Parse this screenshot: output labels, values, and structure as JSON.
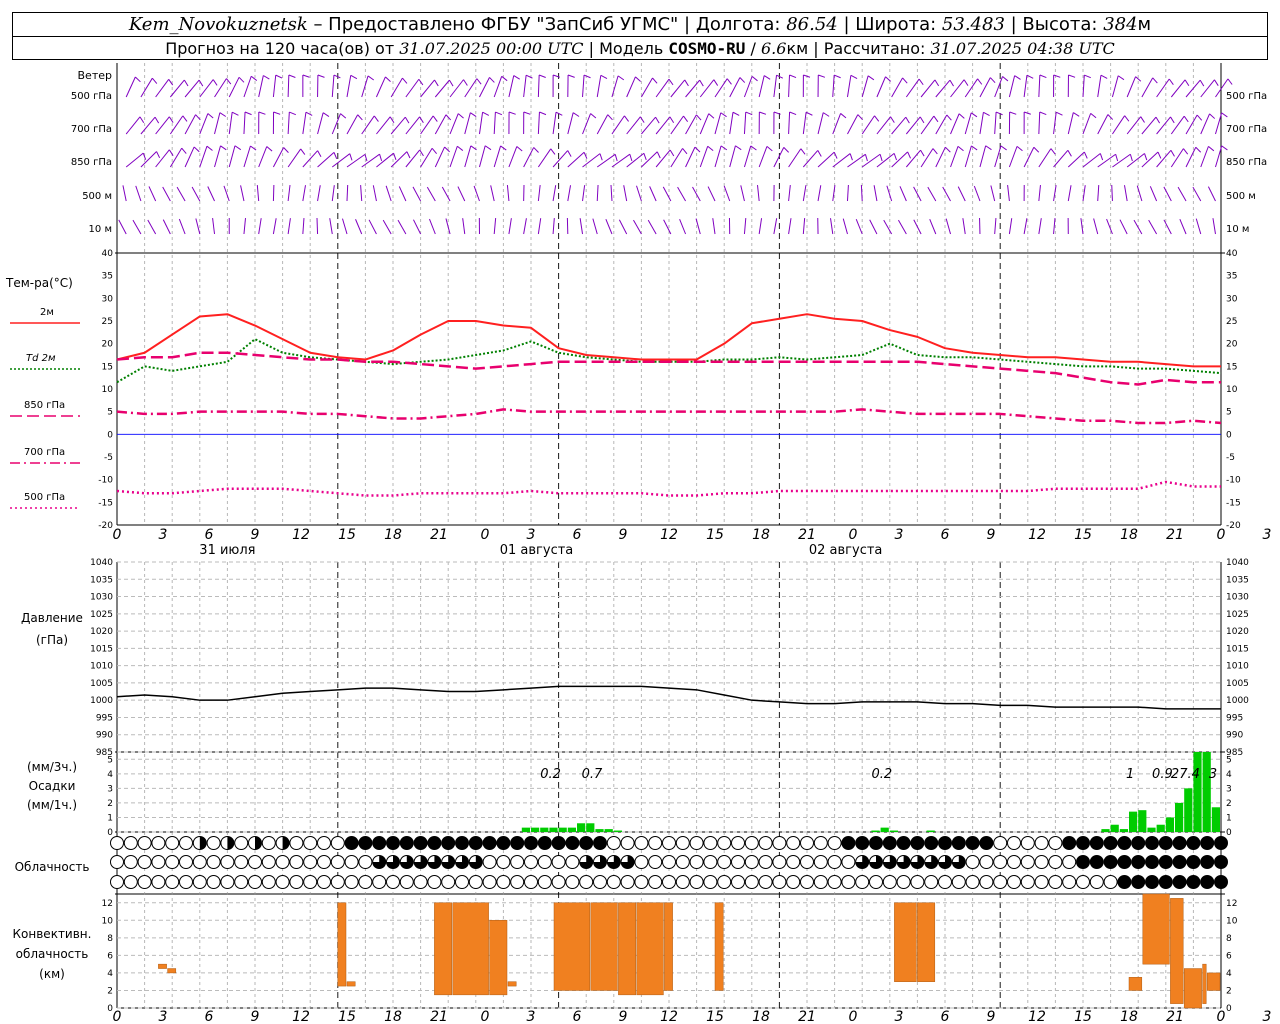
{
  "header": {
    "station": "Kem_Novokuznetsk",
    "sep1": " – Предоставлено ФГБУ \"ЗапСиб УГМС\" | Долгота: ",
    "lon": "86.54",
    "sep2": " | Широта: ",
    "lat": "53.483",
    "sep3": " | Высота: ",
    "alt": "384",
    "alt_unit": "м",
    "line2_a": "Прогноз на 120 часа(ов) от ",
    "run": "31.07.2025 00:00 UTC",
    "line2_b": "  | Модель ",
    "model": "COSMO-RU",
    "line2_c": " / ",
    "res": "6.6",
    "res_unit": "км",
    "line2_d": " | Рассчитано: ",
    "calc": "31.07.2025 04:38 UTC"
  },
  "colors": {
    "t2m": "#ff2020",
    "td": "#008000",
    "t850": "#e8006e",
    "t700": "#e8006e",
    "t500": "#e8008c",
    "wind": "#8000c0",
    "pressure": "#000000",
    "precip": "#00cc00",
    "conv": "#f08020",
    "zero": "#0000ff"
  },
  "time_axis": {
    "hour_ticks": [
      "0",
      "3",
      "6",
      "9",
      "12",
      "15",
      "18",
      "21",
      "0",
      "3",
      "6",
      "9",
      "12",
      "15",
      "18",
      "21",
      "0",
      "3",
      "6",
      "9",
      "12",
      "15",
      "18",
      "21",
      "0",
      "3",
      "6"
    ],
    "days": [
      "31 июля",
      "01 августа",
      "02 августа"
    ]
  },
  "wind_panel": {
    "title": "Ветер",
    "levels": [
      "500 гПа",
      "700 гПа",
      "850 гПа",
      "500 м",
      "10 м"
    ]
  },
  "temp_panel": {
    "title": "Тем-ра(°C)",
    "legend": [
      {
        "label": "2м",
        "style": "solid"
      },
      {
        "label": "Td  2м",
        "style": "dotted"
      },
      {
        "label": "850 гПа",
        "style": "dash"
      },
      {
        "label": "700 гПа",
        "style": "dashdot"
      },
      {
        "label": "500 гПа",
        "style": "dot"
      }
    ],
    "yticks": [
      "40",
      "35",
      "30",
      "25",
      "20",
      "15",
      "10",
      "5",
      "0",
      "-5",
      "-10",
      "-15",
      "-20"
    ]
  },
  "pressure_panel": {
    "title": "Давление",
    "unit": "(гПа)",
    "yticks": [
      "1040",
      "1035",
      "1030",
      "1025",
      "1020",
      "1015",
      "1010",
      "1005",
      "1000",
      "995",
      "990",
      "985"
    ]
  },
  "precip_panel": {
    "label1": "(мм/3ч.)",
    "label2": "Осадки",
    "label3": "(мм/1ч.)",
    "yticks": [
      "5",
      "4",
      "3",
      "2",
      "1",
      "0"
    ],
    "annotations": [
      {
        "h": 48,
        "text": "0.2"
      },
      {
        "h": 52.5,
        "text": "0.7"
      },
      {
        "h": 84,
        "text": "0.2"
      },
      {
        "h": 111,
        "text": "1"
      },
      {
        "h": 114.5,
        "text": "0.9"
      },
      {
        "h": 117,
        "text": "27.4"
      },
      {
        "h": 120,
        "text": "3"
      }
    ]
  },
  "cloud_panel": {
    "title": "Облачность"
  },
  "conv_panel": {
    "title1": "Конвективн.",
    "title2": "облачность",
    "title3": "(км)",
    "yticks": [
      "12",
      "10",
      "8",
      "6",
      "4",
      "2",
      "0"
    ]
  },
  "chart_data": [
    {
      "type": "line",
      "name": "temperature",
      "x_unit": "hours from 31.07.2025 00 UTC",
      "ylim": [
        -20,
        40
      ],
      "series": [
        {
          "name": "2м",
          "x": [
            0,
            3,
            6,
            9,
            12,
            15,
            18,
            21,
            24,
            27,
            30,
            33,
            36,
            39,
            42,
            45,
            48,
            51,
            54,
            57,
            60,
            63,
            66,
            69,
            72,
            75,
            78,
            81,
            84,
            87,
            90,
            93,
            96,
            99,
            102,
            105,
            108,
            111,
            114,
            117,
            120
          ],
          "values": [
            16.5,
            18,
            22,
            26,
            26.5,
            24,
            21,
            18,
            17,
            16.5,
            18.5,
            22,
            25,
            25,
            24,
            23.5,
            19,
            17.5,
            17,
            16.5,
            16.5,
            16.5,
            20,
            24.5,
            25.5,
            26.5,
            25.5,
            25,
            23,
            21.5,
            19,
            18,
            17.5,
            17,
            17,
            16.5,
            16,
            16,
            15.5,
            15,
            15
          ]
        },
        {
          "name": "Td  2м",
          "x": [
            0,
            3,
            6,
            9,
            12,
            15,
            18,
            21,
            24,
            27,
            30,
            33,
            36,
            39,
            42,
            45,
            48,
            51,
            54,
            57,
            60,
            63,
            66,
            69,
            72,
            75,
            78,
            81,
            84,
            87,
            90,
            93,
            96,
            99,
            102,
            105,
            108,
            111,
            114,
            117,
            120
          ],
          "values": [
            11.5,
            15,
            14,
            15,
            16,
            21,
            18,
            17,
            16.5,
            16,
            15.5,
            16,
            16.5,
            17.5,
            18.5,
            20.5,
            18,
            17,
            16.5,
            16,
            16,
            16,
            16.5,
            16.5,
            17,
            16.5,
            17,
            17.5,
            20,
            17.5,
            17,
            17,
            16.5,
            16,
            15.5,
            15,
            15,
            14.5,
            14.5,
            14,
            13.5
          ]
        },
        {
          "name": "850 гПа",
          "x": [
            0,
            3,
            6,
            9,
            12,
            15,
            18,
            21,
            24,
            27,
            30,
            33,
            36,
            39,
            42,
            45,
            48,
            51,
            54,
            57,
            60,
            63,
            66,
            69,
            72,
            75,
            78,
            81,
            84,
            87,
            90,
            93,
            96,
            99,
            102,
            105,
            108,
            111,
            114,
            117,
            120
          ],
          "values": [
            16.5,
            17,
            17,
            18,
            18,
            17.5,
            17,
            16.5,
            16.5,
            16,
            16,
            15.5,
            15,
            14.5,
            15,
            15.5,
            16,
            16,
            16,
            16,
            16,
            16,
            16,
            16,
            16,
            16,
            16,
            16,
            16,
            16,
            15.5,
            15,
            14.5,
            14,
            13.5,
            12.5,
            11.5,
            11,
            12,
            11.5,
            11.5
          ]
        },
        {
          "name": "700 гПа",
          "x": [
            0,
            3,
            6,
            9,
            12,
            15,
            18,
            21,
            24,
            27,
            30,
            33,
            36,
            39,
            42,
            45,
            48,
            51,
            54,
            57,
            60,
            63,
            66,
            69,
            72,
            75,
            78,
            81,
            84,
            87,
            90,
            93,
            96,
            99,
            102,
            105,
            108,
            111,
            114,
            117,
            120
          ],
          "values": [
            5,
            4.5,
            4.5,
            5,
            5,
            5,
            5,
            4.5,
            4.5,
            4,
            3.5,
            3.5,
            4,
            4.5,
            5.5,
            5,
            5,
            5,
            5,
            5,
            5,
            5,
            5,
            5,
            5,
            5,
            5,
            5.5,
            5,
            4.5,
            4.5,
            4.5,
            4.5,
            4,
            3.5,
            3,
            3,
            2.5,
            2.5,
            3,
            2.5
          ]
        },
        {
          "name": "500 гПа",
          "x": [
            0,
            3,
            6,
            9,
            12,
            15,
            18,
            21,
            24,
            27,
            30,
            33,
            36,
            39,
            42,
            45,
            48,
            51,
            54,
            57,
            60,
            63,
            66,
            69,
            72,
            75,
            78,
            81,
            84,
            87,
            90,
            93,
            96,
            99,
            102,
            105,
            108,
            111,
            114,
            117,
            120
          ],
          "values": [
            -12.5,
            -13,
            -13,
            -12.5,
            -12,
            -12,
            -12,
            -12.5,
            -13,
            -13.5,
            -13.5,
            -13,
            -13,
            -13,
            -13,
            -12.5,
            -13,
            -13,
            -13,
            -13,
            -13.5,
            -13.5,
            -13,
            -13,
            -12.5,
            -12.5,
            -12.5,
            -12.5,
            -12.5,
            -12.5,
            -12.5,
            -12.5,
            -12.5,
            -12.5,
            -12,
            -12,
            -12,
            -12,
            -10.5,
            -11.5,
            -11.5
          ]
        }
      ]
    },
    {
      "type": "line",
      "name": "pressure",
      "ylim": [
        985,
        1040
      ],
      "series": [
        {
          "name": "Давление",
          "x": [
            0,
            3,
            6,
            9,
            12,
            15,
            18,
            21,
            24,
            27,
            30,
            33,
            36,
            39,
            42,
            45,
            48,
            51,
            54,
            57,
            60,
            63,
            66,
            69,
            72,
            75,
            78,
            81,
            84,
            87,
            90,
            93,
            96,
            99,
            102,
            105,
            108,
            111,
            114,
            117,
            120
          ],
          "values": [
            1001,
            1001.5,
            1001,
            1000,
            1000,
            1001,
            1002,
            1002.5,
            1003,
            1003.5,
            1003.5,
            1003,
            1002.5,
            1002.5,
            1003,
            1003.5,
            1004,
            1004,
            1004,
            1004,
            1003.5,
            1003,
            1001.5,
            1000,
            999.5,
            999,
            999,
            999.5,
            999.5,
            999.5,
            999,
            999,
            998.5,
            998.5,
            998,
            998,
            998,
            998,
            997.5,
            997.5,
            997.5
          ]
        }
      ]
    },
    {
      "type": "bar",
      "name": "precipitation",
      "ylim": [
        0,
        5.5
      ],
      "series": [
        {
          "name": "Осадки",
          "x": [
            45,
            46,
            47,
            48,
            49,
            50,
            51,
            52,
            53,
            54,
            55,
            83,
            84,
            85,
            89,
            108,
            109,
            110,
            111,
            112,
            113,
            114,
            115,
            116,
            117,
            118,
            119,
            120
          ],
          "values": [
            0.3,
            0.3,
            0.3,
            0.3,
            0.3,
            0.3,
            0.6,
            0.6,
            0.2,
            0.2,
            0.1,
            0.1,
            0.3,
            0.1,
            0.1,
            0.2,
            0.5,
            0.2,
            1.4,
            1.5,
            0.3,
            0.5,
            1.0,
            2.0,
            3.0,
            5.5,
            5.5,
            1.7
          ]
        }
      ]
    },
    {
      "type": "bar",
      "name": "convective_cloud",
      "ylim": [
        0,
        13
      ],
      "series": [
        {
          "name": "Конвективн. облачность",
          "x_start": [
            4.5,
            5.5,
            24,
            25,
            34.5,
            36.5,
            40.5,
            42.5,
            47.5,
            51.5,
            54.5,
            56.5,
            59.5,
            65,
            67,
            84.5,
            87,
            110,
            111.5,
            114.5,
            116,
            118,
            118.5
          ],
          "x_end": [
            5.5,
            6.5,
            25,
            26,
            36.5,
            40.5,
            42.5,
            43.5,
            51.5,
            54.5,
            56.5,
            59.5,
            60.5,
            66,
            68,
            87,
            89,
            111.5,
            114.5,
            116,
            118,
            118.5,
            120
          ],
          "base": [
            4.5,
            4,
            2.5,
            2.5,
            1.5,
            1.5,
            1.5,
            2.5,
            2,
            2,
            1.5,
            1.5,
            2,
            2,
            3,
            3,
            3,
            2,
            5,
            0.5,
            0,
            0.5,
            2
          ],
          "top": [
            5,
            4.5,
            12,
            3,
            12,
            12,
            10,
            3,
            12,
            12,
            12,
            12,
            12,
            12,
            3,
            12,
            12,
            3.5,
            13,
            12.5,
            4.5,
            5,
            4
          ]
        }
      ]
    }
  ]
}
